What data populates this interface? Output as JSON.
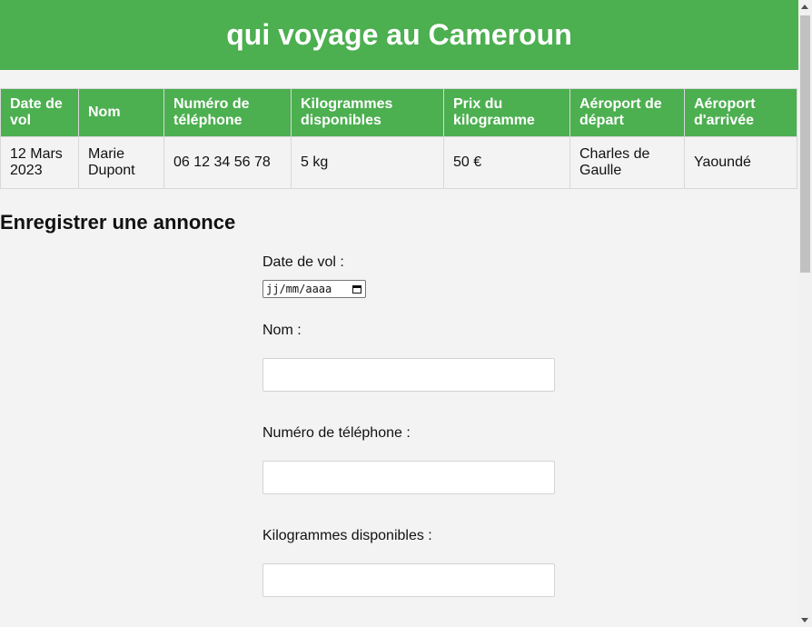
{
  "header": {
    "title": "qui voyage au Cameroun"
  },
  "table": {
    "columns": [
      "Date de vol",
      "Nom",
      "Numéro de téléphone",
      "Kilogrammes disponibles",
      "Prix du kilogramme",
      "Aéroport de départ",
      "Aéroport d'arrivée"
    ],
    "rows": [
      [
        "12 Mars 2023",
        "Marie Dupont",
        "06 12 34 56 78",
        "5 kg",
        "50 €",
        "Charles de Gaulle",
        "Yaoundé"
      ]
    ]
  },
  "form": {
    "heading": "Enregistrer une annonce",
    "date_label": "Date de vol :",
    "date_placeholder": "jj/mm/aaaa",
    "name_label": "Nom :",
    "phone_label": "Numéro de téléphone :",
    "kg_label": "Kilogrammes disponibles :"
  },
  "colors": {
    "accent": "#4caf50",
    "background": "#f3f3f3"
  },
  "icons": {
    "date_picker": "calendar-icon"
  }
}
